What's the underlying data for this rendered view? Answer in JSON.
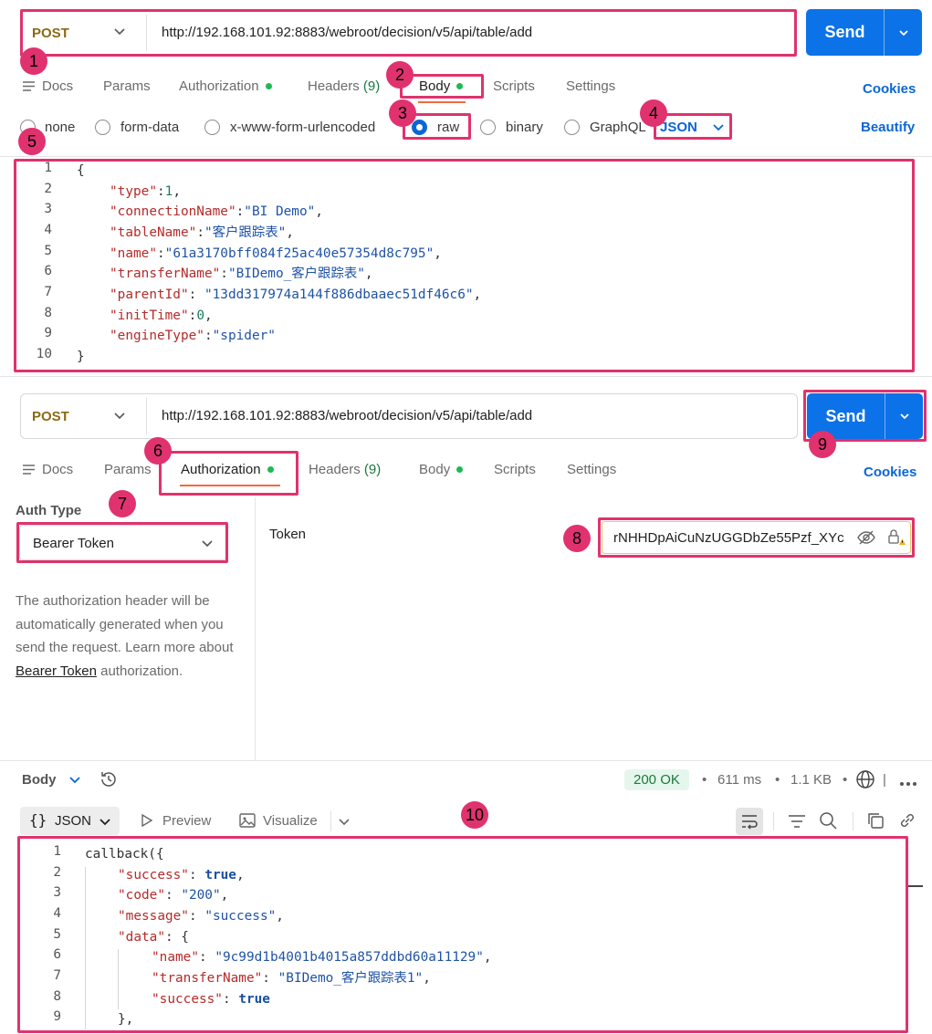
{
  "top": {
    "method": "POST",
    "url": "http://192.168.101.92:8883/webroot/decision/v5/api/table/add",
    "send": "Send",
    "tabs": {
      "docs": "Docs",
      "params": "Params",
      "authorization": "Authorization",
      "headers": "Headers",
      "headers_count": "(9)",
      "body": "Body",
      "scripts": "Scripts",
      "settings": "Settings"
    },
    "cookies": "Cookies",
    "body_types": {
      "none": "none",
      "form_data": "form-data",
      "urlencoded": "x-www-form-urlencoded",
      "raw": "raw",
      "binary": "binary",
      "graphql": "GraphQL"
    },
    "format": "JSON",
    "beautify": "Beautify",
    "code": {
      "line_numbers": [
        "1",
        "2",
        "3",
        "4",
        "5",
        "6",
        "7",
        "8",
        "9",
        "10"
      ],
      "open": "{",
      "close": "}",
      "type_key": "\"type\"",
      "type_val": "1",
      "conn_key": "\"connectionName\"",
      "conn_val": "\"BI Demo\"",
      "tbl_key": "\"tableName\"",
      "tbl_val": "\"客户跟踪表\"",
      "name_key": "\"name\"",
      "name_val": "\"61a3170bff084f25ac40e57354d8c795\"",
      "transfer_key": "\"transferName\"",
      "transfer_val": "\"BIDemo_客户跟踪表\"",
      "parent_key": "\"parentId\"",
      "parent_val": "\"13dd317974a144f886dbaaec51df46c6\"",
      "init_key": "\"initTime\"",
      "init_val": "0",
      "engine_key": "\"engineType\"",
      "engine_val": "\"spider\""
    }
  },
  "second": {
    "method": "POST",
    "url": "http://192.168.101.92:8883/webroot/decision/v5/api/table/add",
    "send": "Send",
    "tabs": {
      "docs": "Docs",
      "params": "Params",
      "authorization": "Authorization",
      "headers": "Headers",
      "headers_count": "(9)",
      "body": "Body",
      "scripts": "Scripts",
      "settings": "Settings"
    },
    "cookies": "Cookies",
    "auth_type_label": "Auth Type",
    "auth_type_value": "Bearer Token",
    "auth_desc_1": "The authorization header will be automatically generated when you send the request. Learn more about ",
    "auth_desc_link": "Bearer Token",
    "auth_desc_2": " authorization.",
    "token_label": "Token",
    "token_value": "rNHHDpAiCuNzUGGDbZe55Pzf_XYc"
  },
  "response": {
    "body_label": "Body",
    "status": "200 OK",
    "time": "611 ms",
    "size": "1.1 KB",
    "format": "JSON",
    "preview": "Preview",
    "visualize": "Visualize",
    "code": {
      "line_numbers": [
        "1",
        "2",
        "3",
        "4",
        "5",
        "6",
        "7",
        "8",
        "9"
      ],
      "callback": "callback({",
      "success_key": "\"success\"",
      "success_val": "true",
      "code_key": "\"code\"",
      "code_val": "\"200\"",
      "message_key": "\"message\"",
      "message_val": "\"success\"",
      "data_key": "\"data\"",
      "name_key": "\"name\"",
      "name_val": "\"9c99d1b4001b4015a857ddbd60a11129\"",
      "transfer_key": "\"transferName\"",
      "transfer_val": "\"BIDemo_客户跟踪表1\"",
      "inner_success_key": "\"success\"",
      "inner_success_val": "true",
      "close": "},"
    }
  },
  "badges": [
    "1",
    "2",
    "3",
    "4",
    "5",
    "6",
    "7",
    "8",
    "9",
    "10"
  ],
  "colors": {
    "accent": "#0c72e8",
    "highlight": "#e0326e",
    "method": "#8a6a13",
    "status_ok_bg": "#e5f7ec",
    "status_ok_text": "#1b7a3e"
  }
}
